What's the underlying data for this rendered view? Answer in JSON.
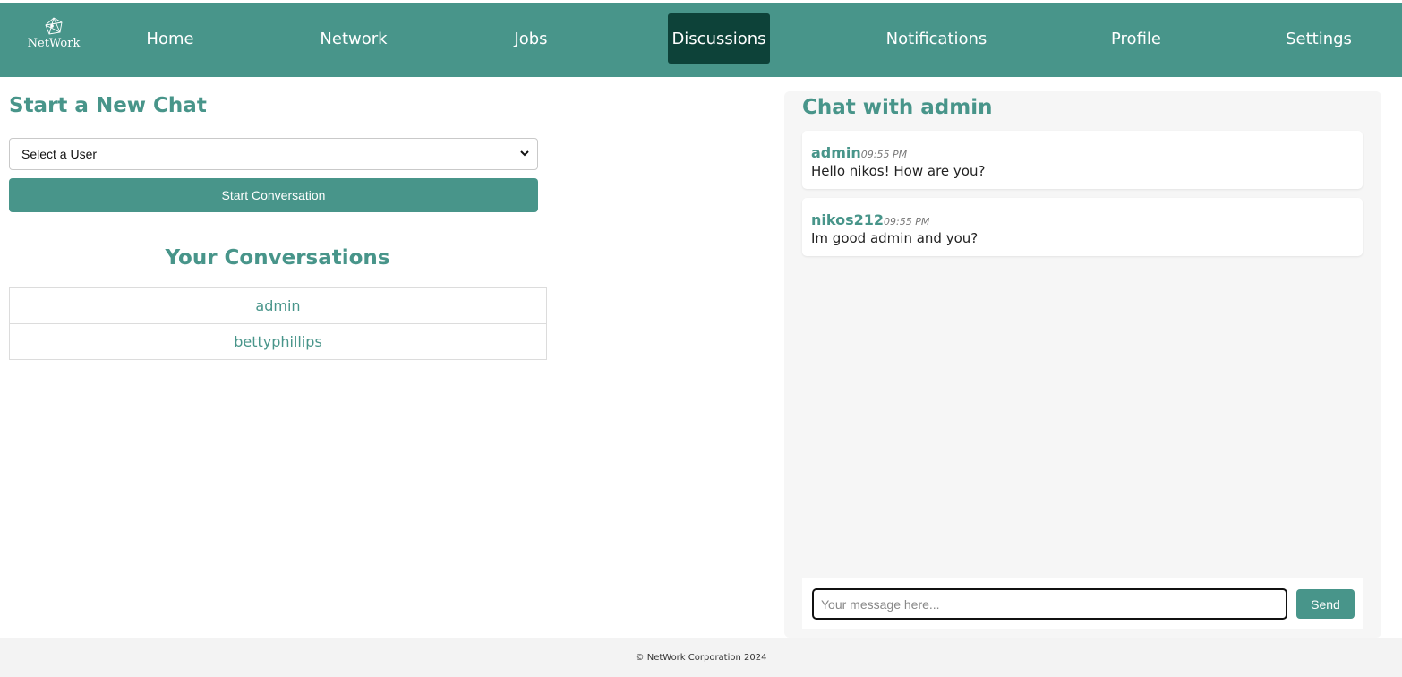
{
  "brand": {
    "name": "NetWork",
    "color": "#48958a",
    "active_color": "#0d4239"
  },
  "nav": {
    "items": [
      {
        "label": "Home"
      },
      {
        "label": "Network"
      },
      {
        "label": "Jobs"
      },
      {
        "label": "Discussions",
        "active": true
      },
      {
        "label": "Notifications"
      },
      {
        "label": "Profile"
      },
      {
        "label": "Settings"
      }
    ]
  },
  "new_chat": {
    "title": "Start a New Chat",
    "select_value": "Select a User",
    "button_label": "Start Conversation"
  },
  "conversations": {
    "title": "Your Conversations",
    "items": [
      "admin",
      "bettyphillips"
    ]
  },
  "chat": {
    "title": "Chat with admin",
    "messages": [
      {
        "sender": "admin",
        "time": "09:55 PM",
        "text": "Hello nikos! How are you?"
      },
      {
        "sender": "nikos212",
        "time": "09:55 PM",
        "text": "Im good admin and you?"
      }
    ],
    "input_placeholder": "Your message here...",
    "send_label": "Send"
  },
  "footer": {
    "text": "© NetWork Corporation 2024"
  }
}
